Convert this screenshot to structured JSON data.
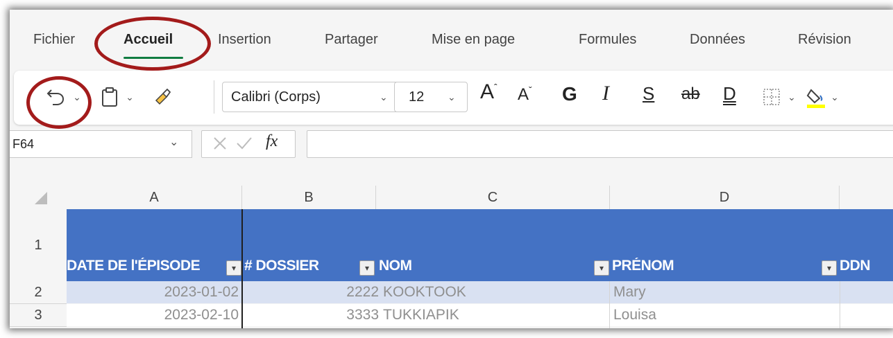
{
  "menu": {
    "tabs": [
      {
        "label": "Fichier"
      },
      {
        "label": "Accueil"
      },
      {
        "label": "Insertion"
      },
      {
        "label": "Partager"
      },
      {
        "label": "Mise en page"
      },
      {
        "label": "Formules"
      },
      {
        "label": "Données"
      },
      {
        "label": "Révision"
      }
    ],
    "active_tab": "Accueil"
  },
  "ribbon": {
    "font_name": "Calibri (Corps)",
    "font_size": "12",
    "grow_label": "A",
    "shrink_label": "A",
    "bold_label": "G",
    "italic_label": "I",
    "underline_label": "S",
    "strike_label": "ab",
    "double_underline_label": "D",
    "fill_color": "#ffff00"
  },
  "formula_bar": {
    "name_box": "F64",
    "fx_label": "fx",
    "formula": ""
  },
  "grid": {
    "columns": [
      "A",
      "B",
      "C",
      "D"
    ],
    "rows": [
      "1",
      "2",
      "3"
    ],
    "table_header": [
      "DATE DE l'ÉPISODE",
      "# DOSSIER",
      "NOM",
      "PRÉNOM",
      "DDN"
    ],
    "data": [
      {
        "date": "2023-01-02",
        "dossier": "2222",
        "nom": "KOOKTOOK",
        "prenom": "Mary"
      },
      {
        "date": "2023-02-10",
        "dossier": "3333",
        "nom": "TUKKIAPIK",
        "prenom": "Louisa"
      }
    ],
    "header_color": "#4472c4",
    "band_color": "#d9e1f2"
  },
  "annotations": {
    "color": "#a31b1b"
  }
}
